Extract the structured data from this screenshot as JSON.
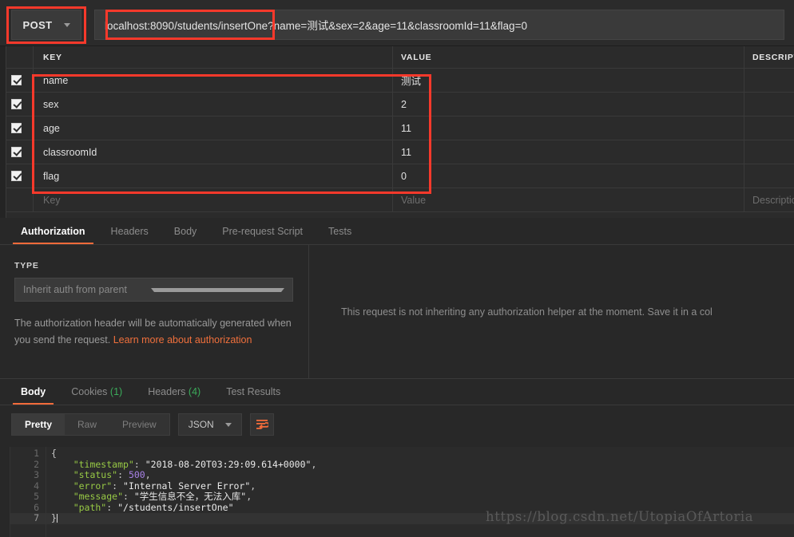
{
  "request": {
    "method": "POST",
    "url": "localhost:8090/students/insertOne?name=测试&sex=2&age=11&classroomId=11&flag=0"
  },
  "params_table": {
    "headers": {
      "key": "KEY",
      "value": "VALUE",
      "description": "DESCRIPTION"
    },
    "rows": [
      {
        "checked": true,
        "key": "name",
        "value": "测试",
        "description": ""
      },
      {
        "checked": true,
        "key": "sex",
        "value": "2",
        "description": ""
      },
      {
        "checked": true,
        "key": "age",
        "value": "11",
        "description": ""
      },
      {
        "checked": true,
        "key": "classroomId",
        "value": "11",
        "description": ""
      },
      {
        "checked": true,
        "key": "flag",
        "value": "0",
        "description": ""
      }
    ],
    "placeholders": {
      "key": "Key",
      "value": "Value",
      "description": "Description"
    }
  },
  "request_tabs": [
    {
      "label": "Authorization",
      "active": true
    },
    {
      "label": "Headers",
      "active": false
    },
    {
      "label": "Body",
      "active": false
    },
    {
      "label": "Pre-request Script",
      "active": false
    },
    {
      "label": "Tests",
      "active": false
    }
  ],
  "auth": {
    "type_label": "TYPE",
    "selected_type": "Inherit auth from parent",
    "note_text": "The authorization header will be automatically generated when you send the request. ",
    "note_link": "Learn more about authorization",
    "right_message": "This request is not inheriting any authorization helper at the moment. Save it in a col"
  },
  "response_tabs": [
    {
      "label": "Body",
      "count": "",
      "active": true
    },
    {
      "label": "Cookies",
      "count": "(1)",
      "active": false
    },
    {
      "label": "Headers",
      "count": "(4)",
      "active": false
    },
    {
      "label": "Test Results",
      "count": "",
      "active": false
    }
  ],
  "format_bar": {
    "modes": [
      {
        "label": "Pretty",
        "active": true
      },
      {
        "label": "Raw",
        "active": false
      },
      {
        "label": "Preview",
        "active": false
      }
    ],
    "language": "JSON",
    "wrap_icon": "word-wrap-icon"
  },
  "response_body": {
    "line_numbers": [
      "1",
      "2",
      "3",
      "4",
      "5",
      "6",
      "7"
    ],
    "active_line": 7,
    "lines": [
      {
        "n": 1,
        "tokens": [
          {
            "t": "pun",
            "v": "{"
          }
        ]
      },
      {
        "n": 2,
        "tokens": [
          {
            "t": "key",
            "v": "    \"timestamp\""
          },
          {
            "t": "pun",
            "v": ": "
          },
          {
            "t": "str",
            "v": "\"2018-08-20T03:29:09.614+0000\""
          },
          {
            "t": "pun",
            "v": ","
          }
        ]
      },
      {
        "n": 3,
        "tokens": [
          {
            "t": "key",
            "v": "    \"status\""
          },
          {
            "t": "pun",
            "v": ": "
          },
          {
            "t": "num",
            "v": "500"
          },
          {
            "t": "pun",
            "v": ","
          }
        ]
      },
      {
        "n": 4,
        "tokens": [
          {
            "t": "key",
            "v": "    \"error\""
          },
          {
            "t": "pun",
            "v": ": "
          },
          {
            "t": "str",
            "v": "\"Internal Server Error\""
          },
          {
            "t": "pun",
            "v": ","
          }
        ]
      },
      {
        "n": 5,
        "tokens": [
          {
            "t": "key",
            "v": "    \"message\""
          },
          {
            "t": "pun",
            "v": ": "
          },
          {
            "t": "str",
            "v": "\"学生信息不全，无法入库\""
          },
          {
            "t": "pun",
            "v": ","
          }
        ]
      },
      {
        "n": 6,
        "tokens": [
          {
            "t": "key",
            "v": "    \"path\""
          },
          {
            "t": "pun",
            "v": ": "
          },
          {
            "t": "str",
            "v": "\"/students/insertOne\""
          }
        ]
      },
      {
        "n": 7,
        "tokens": [
          {
            "t": "pun",
            "v": "}"
          }
        ]
      }
    ]
  },
  "watermark": "https://blog.csdn.net/UtopiaOfArtoria",
  "colors": {
    "accent_orange": "#f26b3a",
    "annotation_red": "#f8392b",
    "json_key_green": "#97c945",
    "json_number_purple": "#a982e8",
    "tab_count_green": "#3bab5a",
    "background": "#282828"
  }
}
